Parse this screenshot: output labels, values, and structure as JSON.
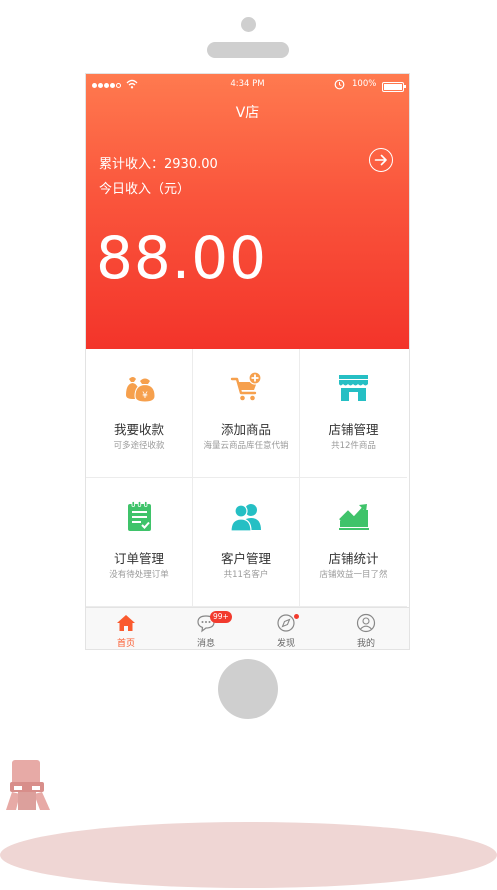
{
  "status_bar": {
    "time": "4:34 PM",
    "battery": "100%"
  },
  "header": {
    "title": "V店"
  },
  "summary": {
    "total_label": "累计收入：2930.00",
    "today_label": "今日收入（元）",
    "today_amount": "88.00"
  },
  "grid": [
    {
      "title": "我要收款",
      "subtitle": "可多途径收款",
      "icon": "money-bag-icon",
      "color": "#f6a04d"
    },
    {
      "title": "添加商品",
      "subtitle": "海量云商品库任意代销",
      "icon": "cart-add-icon",
      "color": "#f6a04d"
    },
    {
      "title": "店铺管理",
      "subtitle": "共12件商品",
      "icon": "store-icon",
      "color": "#25bfc4"
    },
    {
      "title": "订单管理",
      "subtitle": "没有待处理订单",
      "icon": "order-list-icon",
      "color": "#3fc36a"
    },
    {
      "title": "客户管理",
      "subtitle": "共11名客户",
      "icon": "customers-icon",
      "color": "#25bfc4"
    },
    {
      "title": "店铺统计",
      "subtitle": "店铺效益一目了然",
      "icon": "stats-chart-icon",
      "color": "#3fc36a"
    }
  ],
  "tabs": [
    {
      "label": "首页",
      "icon": "home-icon",
      "active": true
    },
    {
      "label": "消息",
      "icon": "message-icon",
      "badge": "99+"
    },
    {
      "label": "发现",
      "icon": "compass-icon"
    },
    {
      "label": "我的",
      "icon": "profile-icon"
    }
  ],
  "colors": {
    "accent": "#fa553c",
    "tab_active": "#fa5a2e"
  }
}
